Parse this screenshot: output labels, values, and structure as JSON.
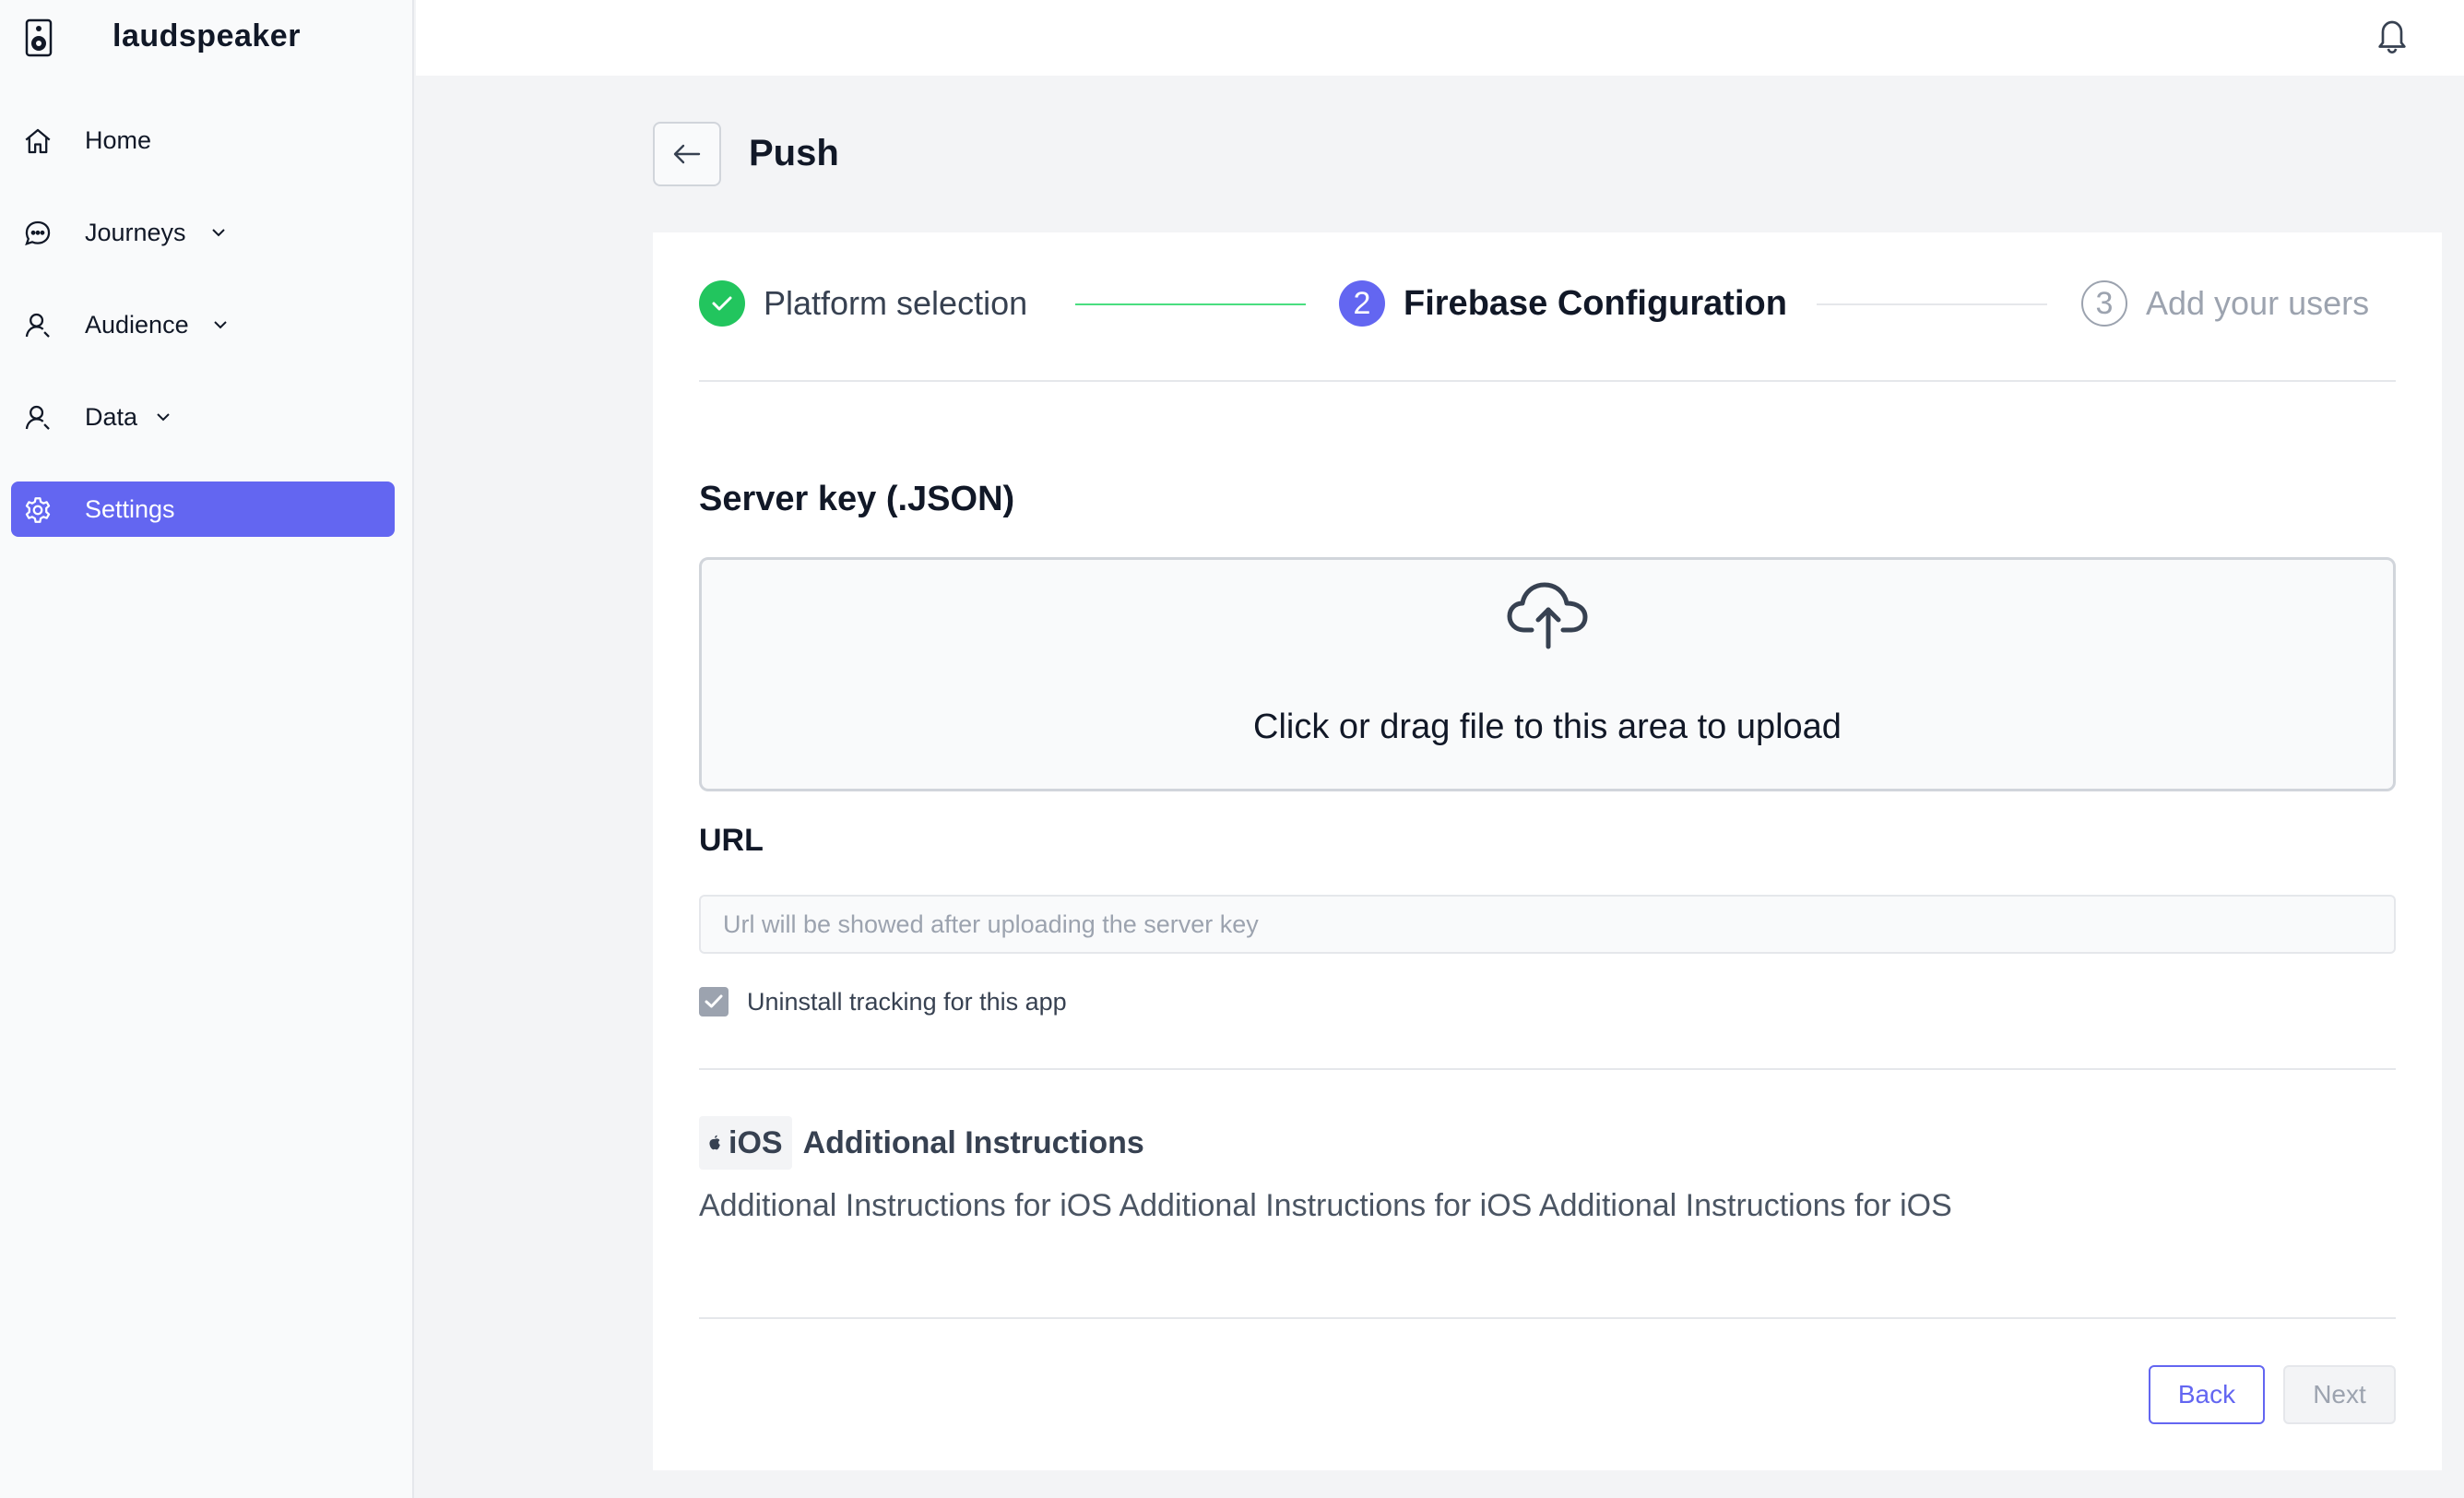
{
  "brand": {
    "name": "laudspeaker"
  },
  "sidebar": {
    "items": [
      {
        "label": "Home",
        "icon": "home-icon",
        "has_chevron": false,
        "active": false
      },
      {
        "label": "Journeys",
        "icon": "chat-bubble-icon",
        "has_chevron": true,
        "active": false
      },
      {
        "label": "Audience",
        "icon": "user-icon",
        "has_chevron": true,
        "active": false
      },
      {
        "label": "Data",
        "icon": "user-icon",
        "has_chevron": true,
        "active": false
      },
      {
        "label": "Settings",
        "icon": "gear-icon",
        "has_chevron": false,
        "active": true
      }
    ]
  },
  "topbar": {
    "icon": "bell-icon"
  },
  "page": {
    "title": "Push",
    "back_icon": "arrow-left-icon"
  },
  "stepper": {
    "steps": [
      {
        "number": "1",
        "label": "Platform selection",
        "status": "complete"
      },
      {
        "number": "2",
        "label": "Firebase Configuration",
        "status": "current"
      },
      {
        "number": "3",
        "label": "Add your users",
        "status": "upcoming"
      }
    ]
  },
  "upload": {
    "title": "Server key (.JSON)",
    "icon": "cloud-upload-icon",
    "text": "Click or drag file to this area to upload"
  },
  "url": {
    "title": "URL",
    "value": "",
    "placeholder": "Url will be showed after uploading the server key"
  },
  "uninstall_tracking": {
    "label": "Uninstall tracking for this app",
    "checked": true
  },
  "ios": {
    "badge": "iOS",
    "heading": "Additional Instructions",
    "description": "Additional Instructions for iOS Additional Instructions for iOS Additional Instructions for iOS"
  },
  "actions": {
    "back_label": "Back",
    "next_label": "Next"
  },
  "colors": {
    "accent": "#6366f1",
    "success": "#22c55e",
    "sidebar_bg": "#f9fafb",
    "page_bg": "#f3f4f6"
  }
}
